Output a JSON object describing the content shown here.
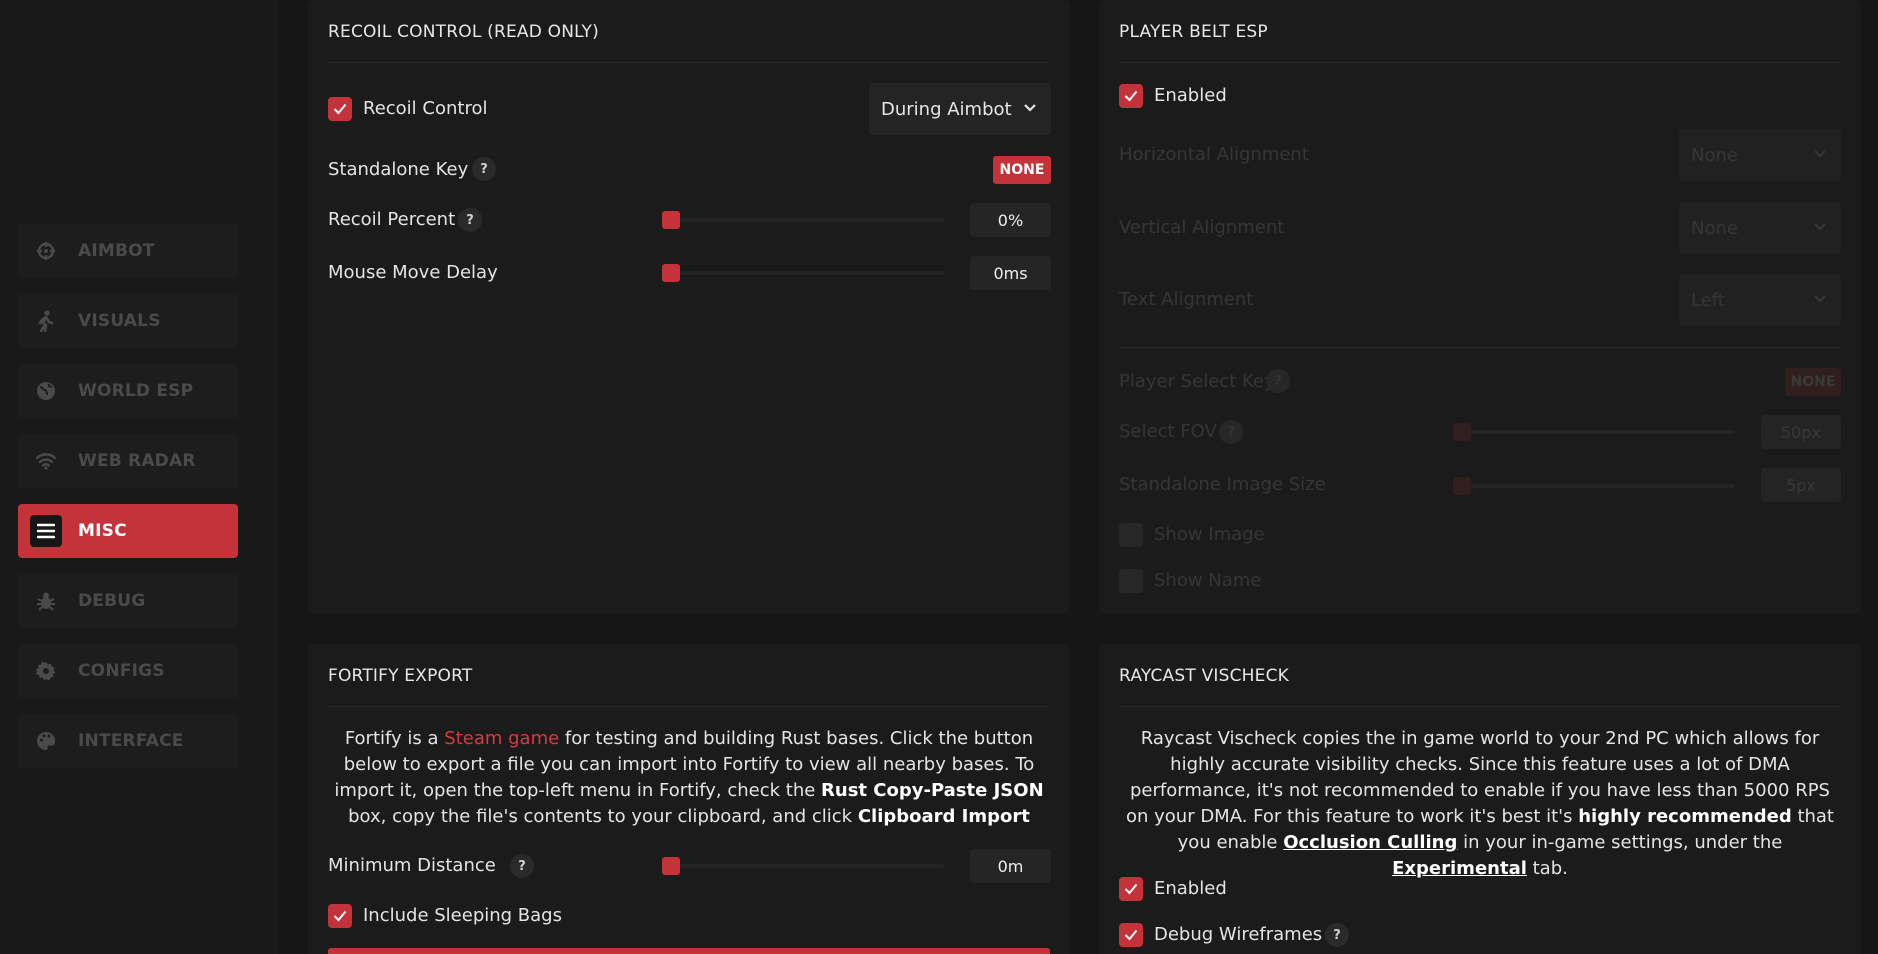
{
  "sidebar": {
    "items": [
      {
        "label": "AIMBOT",
        "icon": "crosshair-icon",
        "active": false
      },
      {
        "label": "VISUALS",
        "icon": "walking-person-icon",
        "active": false
      },
      {
        "label": "WORLD ESP",
        "icon": "globe-icon",
        "active": false
      },
      {
        "label": "WEB RADAR",
        "icon": "wifi-icon",
        "active": false
      },
      {
        "label": "MISC",
        "icon": "hamburger-menu-icon",
        "active": true
      },
      {
        "label": "DEBUG",
        "icon": "bug-icon",
        "active": false
      },
      {
        "label": "CONFIGS",
        "icon": "gear-icon",
        "active": false
      },
      {
        "label": "INTERFACE",
        "icon": "palette-icon",
        "active": false
      }
    ]
  },
  "recoil": {
    "title": "RECOIL CONTROL (READ ONLY)",
    "enabled_label": "Recoil Control",
    "mode_value": "During Aimbot",
    "standalone_key_label": "Standalone Key",
    "standalone_key_value": "NONE",
    "help": "?",
    "percent_label": "Recoil Percent",
    "percent_value": "0%",
    "percent_fraction": 0,
    "delay_label": "Mouse Move Delay",
    "delay_value": "0ms",
    "delay_fraction": 0
  },
  "belt": {
    "title": "PLAYER BELT ESP",
    "enabled_label": "Enabled",
    "h_align_label": "Horizontal Alignment",
    "h_align_value": "None",
    "v_align_label": "Vertical Alignment",
    "v_align_value": "None",
    "t_align_label": "Text Alignment",
    "t_align_value": "Left",
    "select_key_label": "Player Select Key",
    "select_key_value": "NONE",
    "fov_label": "Select FOV",
    "fov_value": "50px",
    "img_size_label": "Standalone Image Size",
    "img_size_value": "5px",
    "show_image_label": "Show Image",
    "show_name_label": "Show Name"
  },
  "fortify": {
    "title": "FORTIFY EXPORT",
    "desc_1": "Fortify is a ",
    "desc_link": "Steam game",
    "desc_2": " for testing and building Rust bases. Click the button below to export a file you can import into Fortify to view all nearby bases. To import it, open the top-left menu in Fortify, check the ",
    "desc_bold1": "Rust Copy-Paste JSON",
    "desc_3": " box, copy the file's contents to your clipboard, and click ",
    "desc_bold2": "Clipboard Import",
    "min_dist_label": "Minimum Distance",
    "min_dist_value": "0m",
    "min_dist_fraction": 0,
    "sleeping_bags_label": "Include Sleeping Bags"
  },
  "raycast": {
    "title": "RAYCAST VISCHECK",
    "desc_1": "Raycast Vischeck copies the in game world to your 2nd PC which allows for highly accurate visibility checks. Since this feature uses a lot of DMA performance, it's not recommended to enable if you have less than 5000 RPS on your DMA. For this feature to work it's best it's ",
    "desc_bold": "highly recommended",
    "desc_2": " that you enable ",
    "desc_u1": "Occlusion Culling",
    "desc_3": " in your in-game settings, under the ",
    "desc_u2": "Experimental",
    "desc_4": " tab.",
    "enabled_label": "Enabled",
    "wireframes_label": "Debug Wireframes"
  },
  "colors": {
    "accent": "#c5333a",
    "background": "#161616",
    "panel": "#1b1b1b"
  }
}
